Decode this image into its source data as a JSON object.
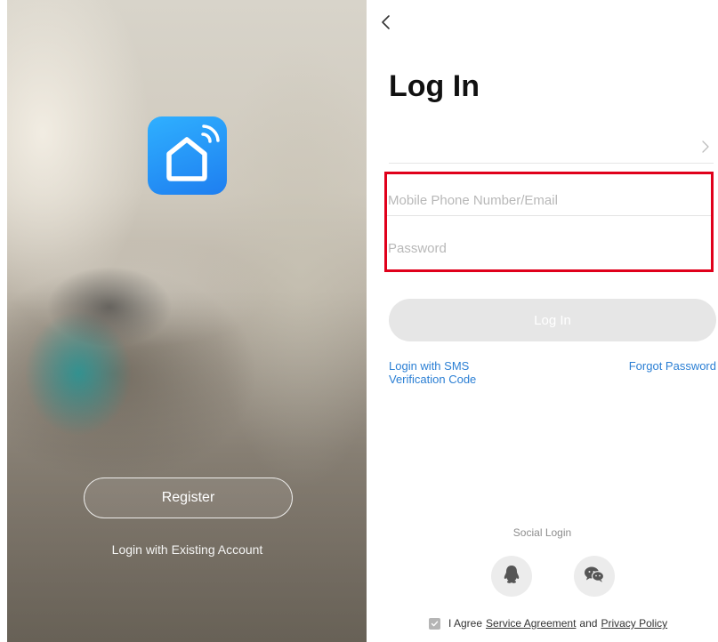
{
  "welcome": {
    "logo_icon": "smart-home-icon",
    "register_label": "Register",
    "existing_account_label": "Login with Existing Account"
  },
  "login": {
    "back_icon": "chevron-left-icon",
    "title": "Log In",
    "region_chevron_icon": "chevron-right-icon",
    "account_field": {
      "placeholder": "Mobile Phone Number/Email",
      "value": ""
    },
    "password_field": {
      "placeholder": "Password",
      "value": ""
    },
    "login_button_label": "Log In",
    "sms_login_label": "Login with SMS Verification Code",
    "forgot_password_label": "Forgot Password",
    "social_login_label": "Social Login",
    "social_providers": [
      {
        "name": "qq-icon"
      },
      {
        "name": "wechat-icon"
      }
    ],
    "agreement": {
      "prefix": "I Agree",
      "service_agreement": "Service Agreement",
      "conjunction": "and",
      "privacy_policy": "Privacy Policy",
      "checked": true
    }
  },
  "colors": {
    "accent_blue": "#2b7fd4",
    "logo_gradient_start": "#2fb0ff",
    "logo_gradient_end": "#1e7ef0",
    "highlight_red": "#e0001b",
    "disabled_button": "#e6e6e6"
  }
}
